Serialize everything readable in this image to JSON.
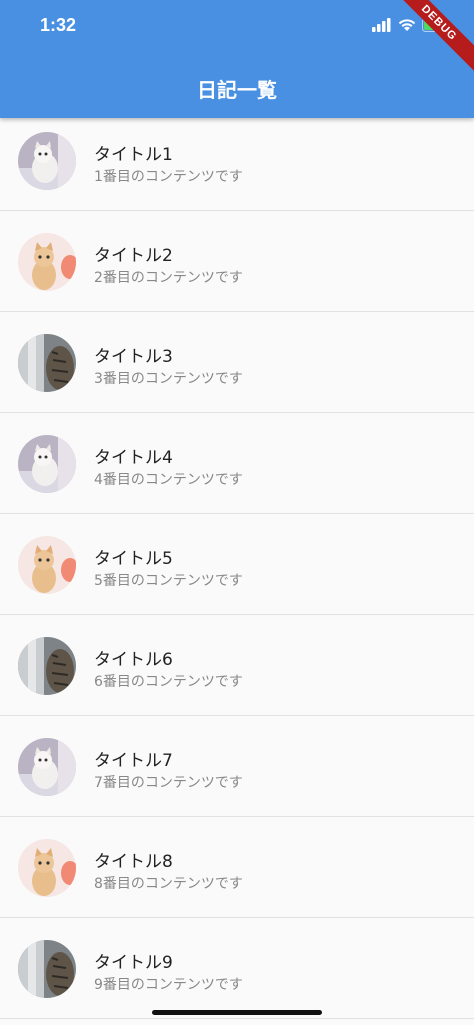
{
  "status_bar": {
    "time": "1:32"
  },
  "debug_banner": "DEBUG",
  "app_bar": {
    "title": "日記一覧"
  },
  "diary_list": [
    {
      "title": "タイトル1",
      "subtitle": "1番目のコンテンツです",
      "image": "white-cat-photo"
    },
    {
      "title": "タイトル2",
      "subtitle": "2番目のコンテンツです",
      "image": "ginger-kitten-photo"
    },
    {
      "title": "タイトル3",
      "subtitle": "3番目のコンテンツです",
      "image": "tabby-cat-photo"
    },
    {
      "title": "タイトル4",
      "subtitle": "4番目のコンテンツです",
      "image": "white-cat-photo"
    },
    {
      "title": "タイトル5",
      "subtitle": "5番目のコンテンツです",
      "image": "ginger-kitten-photo"
    },
    {
      "title": "タイトル6",
      "subtitle": "6番目のコンテンツです",
      "image": "tabby-cat-photo"
    },
    {
      "title": "タイトル7",
      "subtitle": "7番目のコンテンツです",
      "image": "white-cat-photo"
    },
    {
      "title": "タイトル8",
      "subtitle": "8番目のコンテンツです",
      "image": "ginger-kitten-photo"
    },
    {
      "title": "タイトル9",
      "subtitle": "9番目のコンテンツです",
      "image": "tabby-cat-photo"
    }
  ],
  "colors": {
    "app_bar": "#4a90e2",
    "background": "#fafafa",
    "divider": "#e2e2e2",
    "debug": "#b71c1c"
  }
}
